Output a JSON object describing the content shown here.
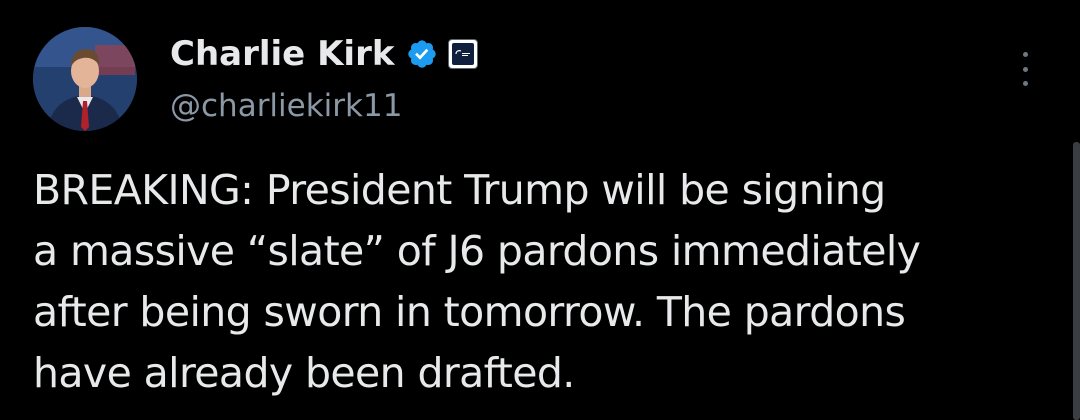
{
  "tweet": {
    "author": {
      "display_name": "Charlie Kirk",
      "handle": "@charliekirk11",
      "verified": true,
      "verified_color": "#1d9bf0",
      "avatar_icon": "profile-photo",
      "affiliation_icon": "organization-badge"
    },
    "text": "BREAKING: President Trump will be signing\na massive “slate” of J6 pardons immediately\nafter being sworn in tomorrow. The pardons\nhave already been drafted.",
    "more_icon": "more-vertical-icon"
  }
}
